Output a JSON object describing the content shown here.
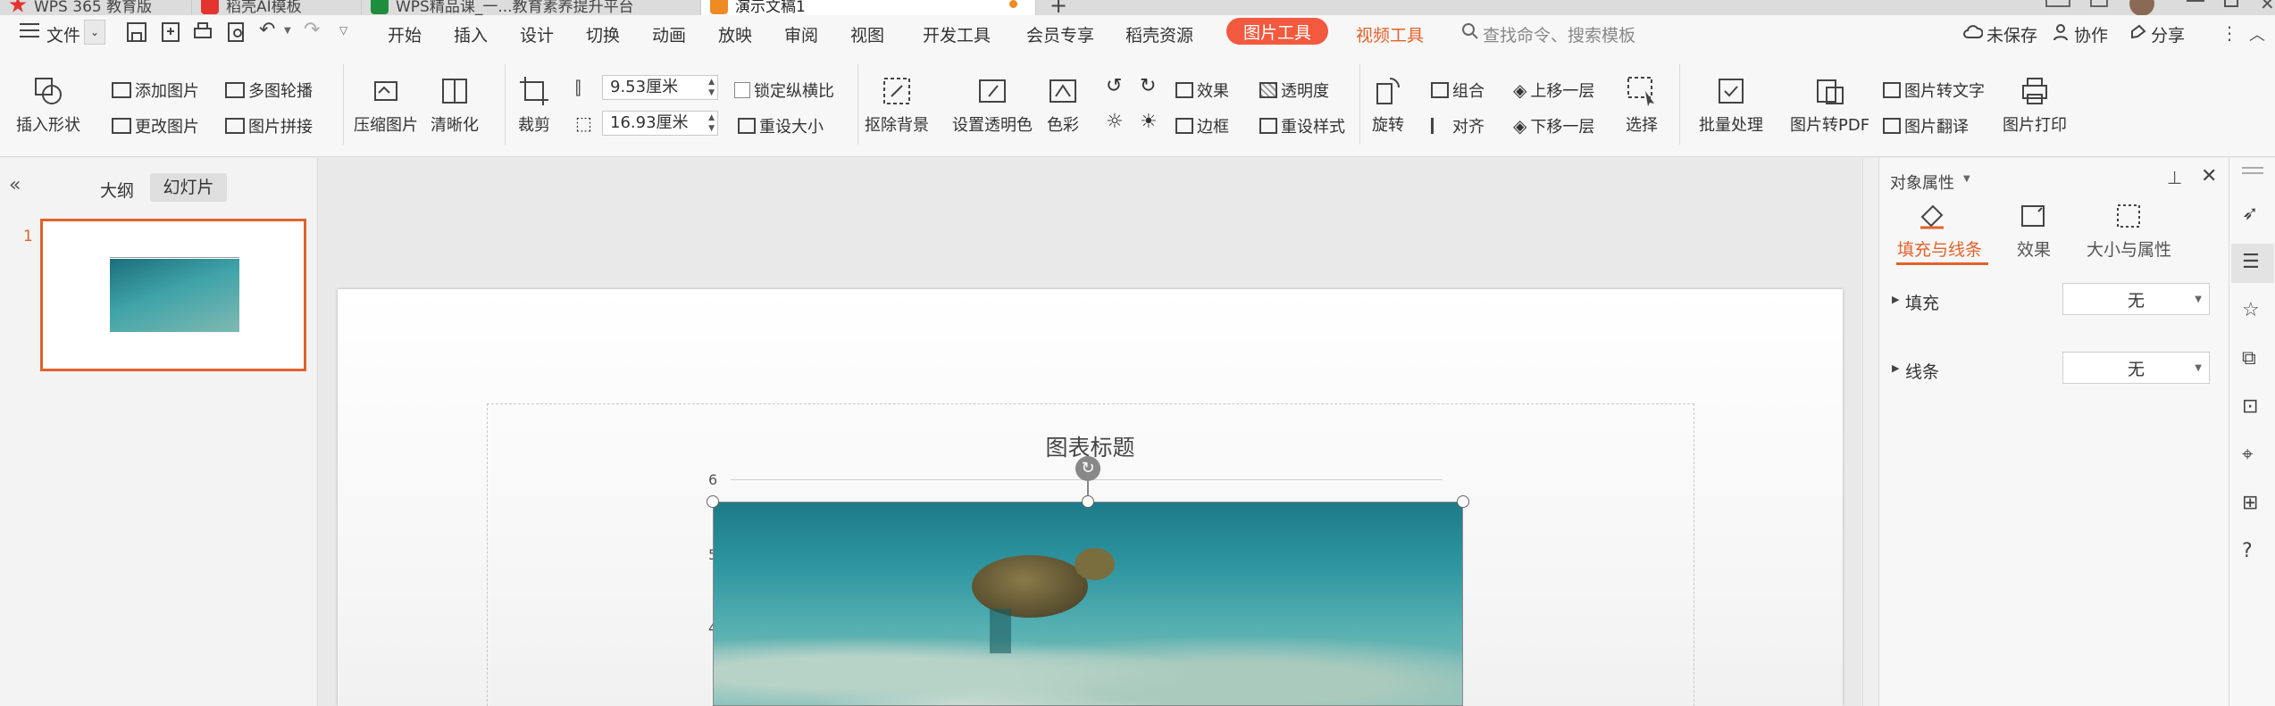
{
  "tabs": [
    {
      "label": "WPS 365 教育版",
      "color": "#e3342f"
    },
    {
      "label": "稻壳AI模板",
      "color": "#e3342f"
    },
    {
      "label": "WPS精品课_一...教育素养提升平台",
      "color": "#1e8e3e"
    },
    {
      "label": "演示文稿1",
      "color": "#f08a24"
    }
  ],
  "new_tab": "+",
  "menu": {
    "file": "文件",
    "items": [
      "开始",
      "插入",
      "设计",
      "切换",
      "动画",
      "放映",
      "审阅",
      "视图",
      "开发工具",
      "会员专享",
      "稻壳资源"
    ],
    "picture_tools": "图片工具",
    "video_tools": "视频工具",
    "search_placeholder": "查找命令、搜索模板",
    "unsaved": "未保存",
    "collab": "协作",
    "share": "分享"
  },
  "ribbon": {
    "insert_shape": "插入形状",
    "add_picture": "添加图片",
    "multi_carousel": "多图轮播",
    "change_picture": "更改图片",
    "picture_splice": "图片拼接",
    "compress": "压缩图片",
    "sharpen": "清晰化",
    "crop": "裁剪",
    "height_value": "9.53厘米",
    "width_value": "16.93厘米",
    "lock_ratio": "锁定纵横比",
    "reset_size": "重设大小",
    "remove_bg": "抠除背景",
    "set_transparent": "设置透明色",
    "color": "色彩",
    "effect": "效果",
    "transparency": "透明度",
    "border": "边框",
    "reset_style": "重设样式",
    "rotate": "旋转",
    "group": "组合",
    "bring_forward": "上移一层",
    "align": "对齐",
    "send_backward": "下移一层",
    "select": "选择",
    "batch": "批量处理",
    "to_pdf": "图片转PDF",
    "to_text": "图片转文字",
    "translate": "图片翻译",
    "print": "图片打印"
  },
  "left_panel": {
    "outline": "大纲",
    "slides": "幻灯片",
    "slide_number": "1"
  },
  "slide": {
    "chart_title": "图表标题",
    "axis_top": "6",
    "axis_5": "5",
    "axis_4": "4"
  },
  "right_panel": {
    "title": "对象属性",
    "tabs": [
      "填充与线条",
      "效果",
      "大小与属性"
    ],
    "fill_label": "填充",
    "fill_value": "无",
    "line_label": "线条",
    "line_value": "无"
  },
  "colors": {
    "accent": "#f2593e",
    "selection_border": "#e2622a",
    "active_tab_text": "#e2622a"
  }
}
